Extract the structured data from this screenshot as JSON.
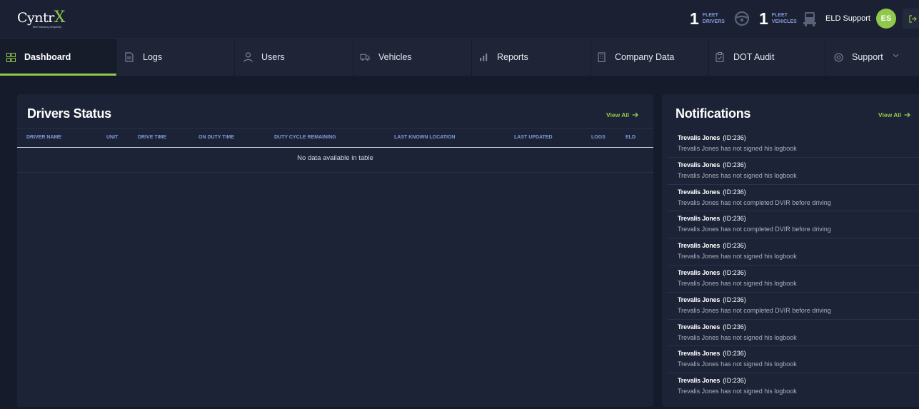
{
  "brand": {
    "logo_main": "Cyntr",
    "logo_accent": "X",
    "logo_tagline": "fleet tracking simplicity"
  },
  "header": {
    "fleet_drivers": {
      "count": "1",
      "label_line1": "FLEET",
      "label_line2": "DRIVERS"
    },
    "fleet_vehicles": {
      "count": "1",
      "label_line1": "FLEET",
      "label_line2": "VEHICLES"
    },
    "user_name": "ELD Support",
    "user_initials": "ES"
  },
  "nav": {
    "items": [
      {
        "label": "Dashboard",
        "icon": "grid-icon",
        "active": true
      },
      {
        "label": "Logs",
        "icon": "document-icon"
      },
      {
        "label": "Users",
        "icon": "user-icon"
      },
      {
        "label": "Vehicles",
        "icon": "truck-icon"
      },
      {
        "label": "Reports",
        "icon": "bar-chart-icon"
      },
      {
        "label": "Company Data",
        "icon": "building-icon"
      },
      {
        "label": "DOT Audit",
        "icon": "clipboard-icon"
      },
      {
        "label": "Support",
        "icon": "lifebuoy-icon",
        "has_dropdown": true
      }
    ]
  },
  "drivers_status": {
    "title": "Drivers Status",
    "view_all": "View All",
    "columns": [
      "DRIVER NAME",
      "UNIT",
      "DRIVE TIME",
      "ON DUTY TIME",
      "DUTY CYCLE REMAINING",
      "LAST KNOWN LOCATION",
      "LAST UPDATED",
      "LOGS",
      "ELD"
    ],
    "empty_message": "No data available in table"
  },
  "notifications": {
    "title": "Notifications",
    "view_all": "View All",
    "items": [
      {
        "name": "Trevalis Jones",
        "id": "(ID:236)",
        "message": "Trevalis Jones has not signed his logbook"
      },
      {
        "name": "Trevalis Jones",
        "id": "(ID:236)",
        "message": "Trevalis Jones has not signed his logbook"
      },
      {
        "name": "Trevalis Jones",
        "id": "(ID:236)",
        "message": "Trevalis Jones has not completed DVIR before driving"
      },
      {
        "name": "Trevalis Jones",
        "id": "(ID:236)",
        "message": "Trevalis Jones has not completed DVIR before driving"
      },
      {
        "name": "Trevalis Jones",
        "id": "(ID:236)",
        "message": "Trevalis Jones has not signed his logbook"
      },
      {
        "name": "Trevalis Jones",
        "id": "(ID:236)",
        "message": "Trevalis Jones has not signed his logbook"
      },
      {
        "name": "Trevalis Jones",
        "id": "(ID:236)",
        "message": "Trevalis Jones has not completed DVIR before driving"
      },
      {
        "name": "Trevalis Jones",
        "id": "(ID:236)",
        "message": "Trevalis Jones has not signed his logbook"
      },
      {
        "name": "Trevalis Jones",
        "id": "(ID:236)",
        "message": "Trevalis Jones has not signed his logbook"
      },
      {
        "name": "Trevalis Jones",
        "id": "(ID:236)",
        "message": "Trevalis Jones has not signed his logbook"
      }
    ]
  },
  "colors": {
    "accent": "#8fc84a",
    "background": "#161b2c",
    "panel": "#1d2336",
    "header_label": "#7f9ad6"
  }
}
